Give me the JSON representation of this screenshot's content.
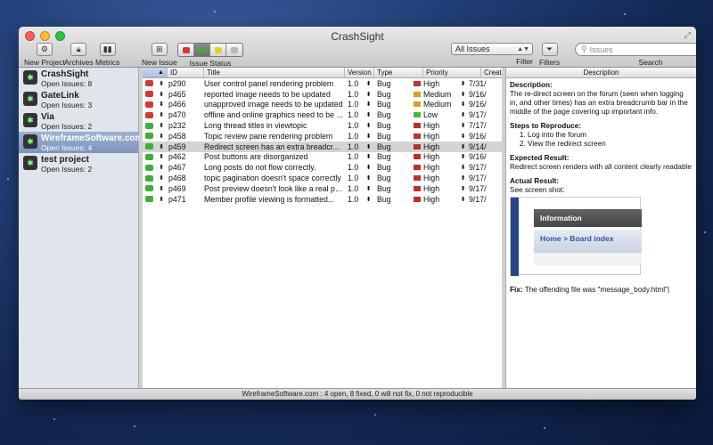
{
  "window": {
    "title": "CrashSight"
  },
  "toolbar": {
    "new_project": "New Project",
    "archives": "Archives",
    "metrics": "Metrics",
    "new_issue": "New Issue",
    "issue_status": "Issue Status",
    "filter_value": "All Issues",
    "filter_label": "Filter",
    "filters_label": "Filters",
    "search_placeholder": "Issues",
    "search_label": "Search"
  },
  "projects": [
    {
      "name": "CrashSight",
      "open": "Open Issues: 8",
      "selected": false
    },
    {
      "name": "GateLink",
      "open": "Open Issues: 3",
      "selected": false
    },
    {
      "name": "Via",
      "open": "Open Issues: 2",
      "selected": false
    },
    {
      "name": "WireframeSoftware.com",
      "open": "Open Issues: 4",
      "selected": true
    },
    {
      "name": "test project",
      "open": "Open Issues: 2",
      "selected": false
    }
  ],
  "table": {
    "headers": {
      "id": "ID",
      "title": "Title",
      "version": "Version",
      "type": "Type",
      "priority": "Priority",
      "created": "Create"
    },
    "rows": [
      {
        "status": "red",
        "id": "p290",
        "title": "User control panel rendering problem",
        "version": "1.0",
        "type": "Bug",
        "priority": "High",
        "pcolor": "#c0302b",
        "created": "7/31/"
      },
      {
        "status": "red",
        "id": "p465",
        "title": "reported image needs to be updated",
        "version": "1.0",
        "type": "Bug",
        "priority": "Medium",
        "pcolor": "#d9a020",
        "created": "9/16/"
      },
      {
        "status": "red",
        "id": "p466",
        "title": "unapproved image needs to be updated",
        "version": "1.0",
        "type": "Bug",
        "priority": "Medium",
        "pcolor": "#d9a020",
        "created": "9/16/"
      },
      {
        "status": "red",
        "id": "p470",
        "title": "offline and online graphics need to be ...",
        "version": "1.0",
        "type": "Bug",
        "priority": "Low",
        "pcolor": "#4bb83a",
        "created": "9/17/"
      },
      {
        "status": "green",
        "id": "p232",
        "title": "Long thread titles in viewtopic",
        "version": "1.0",
        "type": "Bug",
        "priority": "High",
        "pcolor": "#c0302b",
        "created": "7/17/"
      },
      {
        "status": "green",
        "id": "p458",
        "title": "Topic review pane rendering problem",
        "version": "1.0",
        "type": "Bug",
        "priority": "High",
        "pcolor": "#c0302b",
        "created": "9/16/"
      },
      {
        "status": "green",
        "id": "p459",
        "title": "Redirect screen has an extra breadcr...",
        "version": "1.0",
        "type": "Bug",
        "priority": "High",
        "pcolor": "#c0302b",
        "created": "9/14/",
        "selected": true
      },
      {
        "status": "green",
        "id": "p462",
        "title": "Post buttons are disorganized",
        "version": "1.0",
        "type": "Bug",
        "priority": "High",
        "pcolor": "#c0302b",
        "created": "9/16/"
      },
      {
        "status": "green",
        "id": "p467",
        "title": "Long posts do not flow correctly.",
        "version": "1.0",
        "type": "Bug",
        "priority": "High",
        "pcolor": "#c0302b",
        "created": "9/17/"
      },
      {
        "status": "green",
        "id": "p468",
        "title": "topic pagination doesn't space correctly",
        "version": "1.0",
        "type": "Bug",
        "priority": "High",
        "pcolor": "#c0302b",
        "created": "9/17/"
      },
      {
        "status": "green",
        "id": "p469",
        "title": "Post preview doesn't look like a real post",
        "version": "1.0",
        "type": "Bug",
        "priority": "High",
        "pcolor": "#c0302b",
        "created": "9/17/"
      },
      {
        "status": "green",
        "id": "p471",
        "title": "Member profile viewing is formatted...",
        "version": "1.0",
        "type": "Bug",
        "priority": "High",
        "pcolor": "#c0302b",
        "created": "9/17/"
      }
    ]
  },
  "description": {
    "header": "Description",
    "desc_label": "Description:",
    "desc_text": "The re-direct screen on the forum (seen when logging in, and other times) has an extra breadcrumb bar in the middle of the page covering up important info.",
    "steps_label": "Steps to Reproduce:",
    "steps": [
      "Log into the forum",
      "View the redirect screen"
    ],
    "expected_label": "Expected Result:",
    "expected_text": "Redirect screen renders with all content clearly readable",
    "actual_label": "Actual Result:",
    "actual_text": "See screen shot:",
    "shot_info": "Information",
    "shot_crumb": "Home > Board index",
    "fix_label": "Fix:",
    "fix_text": "The offending file was \"message_body.html\""
  },
  "statusbar": "WireframeSoftware.com  :  4 open,  8 fixed,  0 will not fix,  0 not reproducible",
  "colors": {
    "red_status": "#d23a33",
    "green_status": "#3fae3a",
    "selection": "#7d94bb"
  }
}
